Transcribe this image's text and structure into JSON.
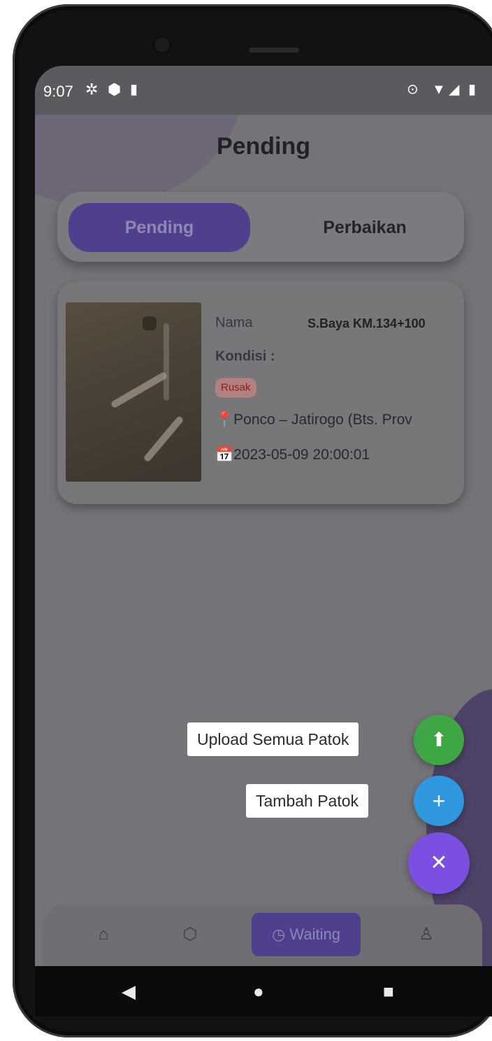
{
  "status_bar": {
    "time": "9:07",
    "left_icons": [
      "gear-icon",
      "shield-icon",
      "sim-card-icon"
    ],
    "right_icons": [
      "location-icon",
      "wifi-icon",
      "signal-icon",
      "battery-icon"
    ]
  },
  "header": {
    "title": "Pending"
  },
  "segmented": {
    "tabs": [
      {
        "label": "Pending",
        "active": true
      },
      {
        "label": "Perbaikan",
        "active": false
      }
    ]
  },
  "card": {
    "name_label": "Nama",
    "name_value": "S.Baya KM.134+100",
    "condition_label": "Kondisi :",
    "condition_badge": "Rusak",
    "location_icon": "pin-icon",
    "location": "Ponco – Jatirogo (Bts. Prov",
    "date_icon": "calendar-icon",
    "date": "2023-05-09 20:00:01"
  },
  "fab_menu": {
    "upload_label": "Upload Semua Patok",
    "upload_icon": "upload-icon",
    "add_label": "Tambah Patok",
    "add_icon": "plus-icon",
    "close_icon": "close-icon"
  },
  "bottom_nav": {
    "items": [
      {
        "icon": "home-icon",
        "label": ""
      },
      {
        "icon": "box-icon",
        "label": ""
      },
      {
        "icon": "clock-icon",
        "label": "Waiting",
        "active": true
      },
      {
        "icon": "user-icon",
        "label": ""
      }
    ]
  },
  "system_nav": [
    "back-icon",
    "home-circle-icon",
    "recents-icon"
  ],
  "colors": {
    "accent": "#503f8d",
    "upload_fab": "#3fa645",
    "add_fab": "#2e97e0",
    "close_fab": "#7c4fe3",
    "badge": "#b28080"
  }
}
